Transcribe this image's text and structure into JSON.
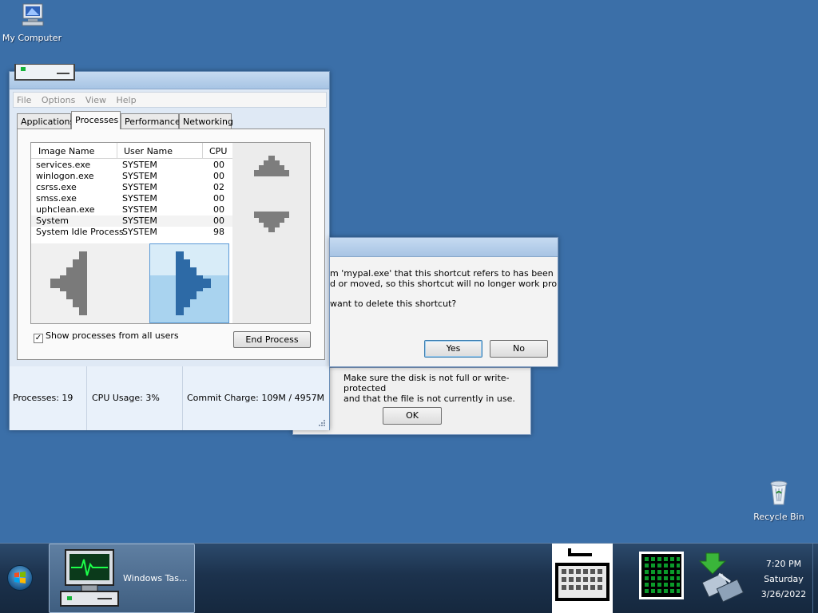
{
  "desktop": {
    "icons": [
      {
        "label": "My Computer",
        "icon": "my-computer-icon"
      },
      {
        "label": "Recycle Bin",
        "icon": "recycle-bin-icon"
      }
    ]
  },
  "task_manager": {
    "menu": [
      "File",
      "Options",
      "View",
      "Help"
    ],
    "tabs": [
      "Applications",
      "Processes",
      "Performance",
      "Networking"
    ],
    "active_tab": "Processes",
    "columns": [
      "Image Name",
      "User Name",
      "CPU"
    ],
    "processes": [
      {
        "name": "services.exe",
        "user": "SYSTEM",
        "cpu": "00"
      },
      {
        "name": "winlogon.exe",
        "user": "SYSTEM",
        "cpu": "00"
      },
      {
        "name": "csrss.exe",
        "user": "SYSTEM",
        "cpu": "02"
      },
      {
        "name": "smss.exe",
        "user": "SYSTEM",
        "cpu": "00"
      },
      {
        "name": "uphclean.exe",
        "user": "SYSTEM",
        "cpu": "00"
      },
      {
        "name": "System",
        "user": "SYSTEM",
        "cpu": "00"
      },
      {
        "name": "System Idle Process",
        "user": "SYSTEM",
        "cpu": "98"
      }
    ],
    "show_all_label": "Show processes from all users",
    "show_all_checked": true,
    "end_process_label": "End Process",
    "status": {
      "processes": "Processes: 19",
      "cpu": "CPU Usage: 3%",
      "commit": "Commit Charge: 109M / 4957M"
    }
  },
  "confirm_dialog": {
    "line1": "m 'mypal.exe' that this shortcut refers to has been",
    "line2": "d or moved, so this shortcut will no longer work properly.",
    "line3": "want to delete this shortcut?",
    "yes_label": "Yes",
    "no_label": "No"
  },
  "error_dialog": {
    "line1": "Make sure the disk is not full or write-protected",
    "line2": "and that the file is not currently in use.",
    "ok_label": "OK"
  },
  "taskbar": {
    "task_label": "Windows Tas...",
    "clock_time": "7:20 PM",
    "clock_day": "Saturday",
    "clock_date": "3/26/2022"
  },
  "colors": {
    "desktop": "#3b6fa8",
    "taskbar": "#1c324d",
    "selected_accent": "#3c7fb1"
  }
}
